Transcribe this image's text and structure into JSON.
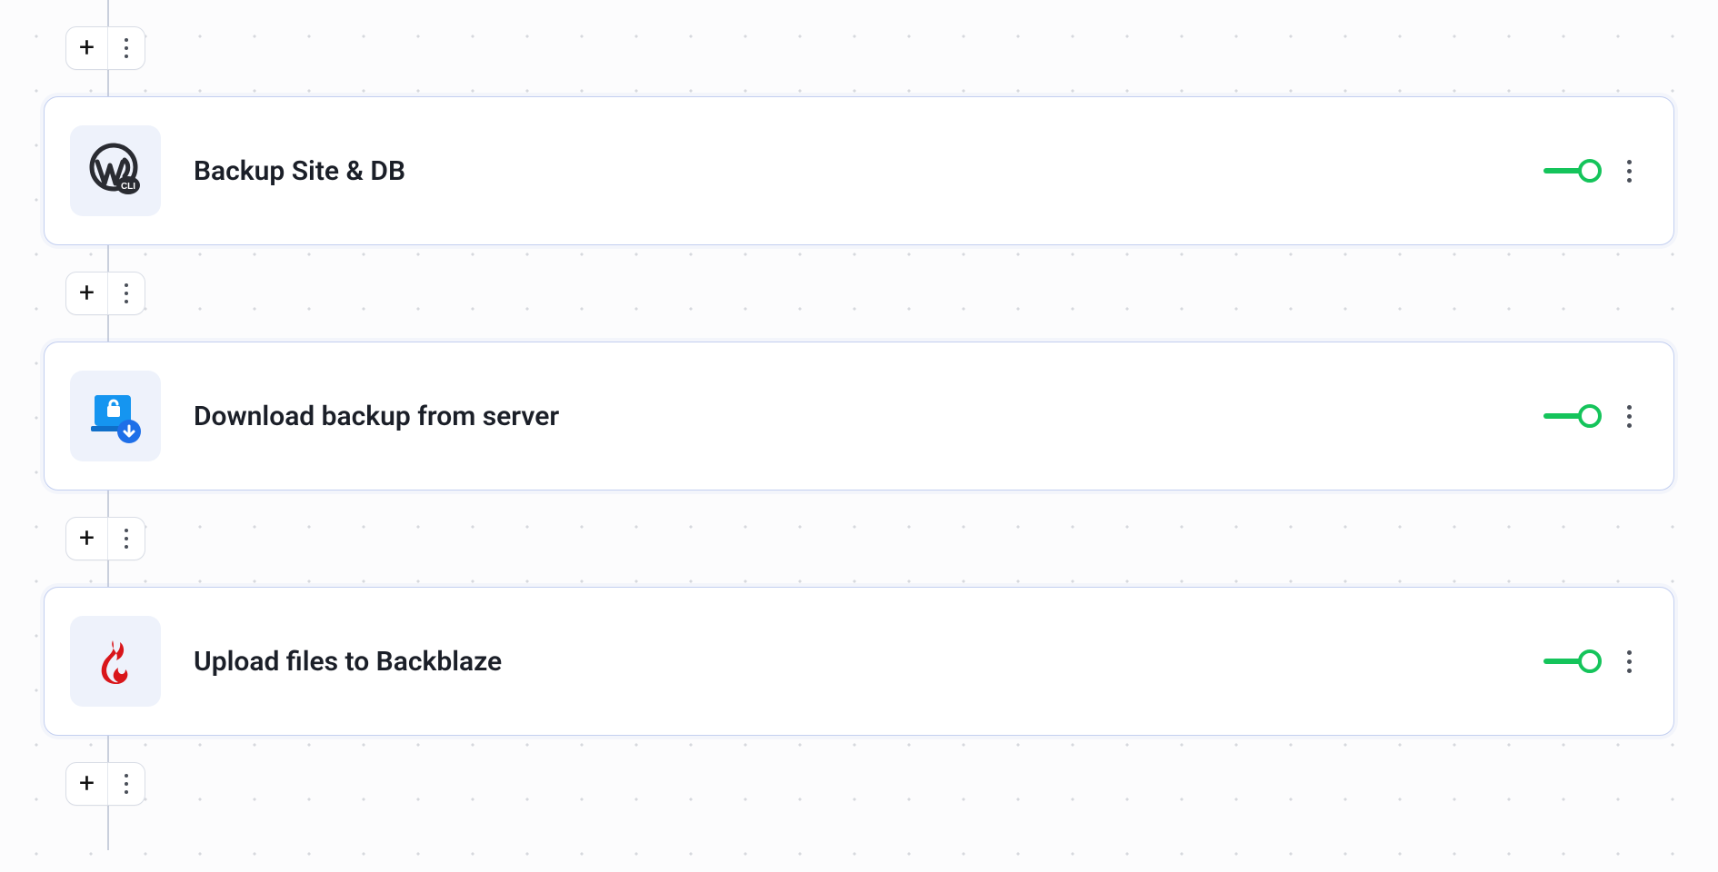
{
  "steps": [
    {
      "title": "Backup Site & DB",
      "icon": "wordpress-cli",
      "enabled": true
    },
    {
      "title": "Download backup from server",
      "icon": "secure-download",
      "enabled": true
    },
    {
      "title": "Upload files to Backblaze",
      "icon": "backblaze-flame",
      "enabled": true
    }
  ],
  "colors": {
    "toggle_on": "#15c45b",
    "card_border": "#c3cff0",
    "icon_bg": "#eef2fb"
  }
}
